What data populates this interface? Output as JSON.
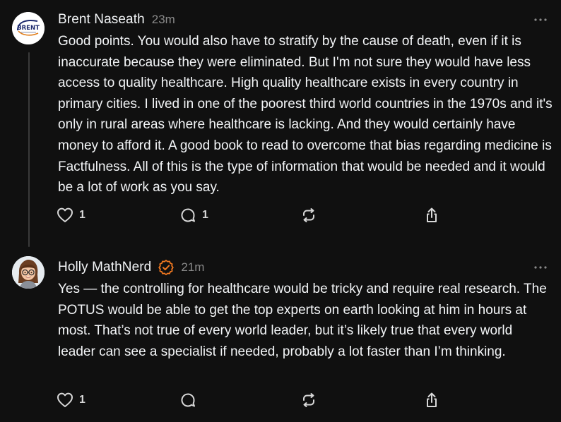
{
  "comments": [
    {
      "author": "Brent Naseath",
      "time": "23m",
      "avatar_logo": "BRENT",
      "verified": false,
      "body": "Good points. You would also have to stratify by the cause of death, even if it is inaccurate because they were eliminated. But I'm not sure they would have less access to quality healthcare. High quality healthcare exists in every country in primary cities. I lived in one of the poorest third world countries in the 1970s and it's only in rural areas where healthcare is lacking. And they would certainly have money to afford it. A good book to read to overcome that bias regarding medicine is Factfulness. All of this is the type of information that would be needed and it would be a lot of work as you say.",
      "likes": "1",
      "replies": "1"
    },
    {
      "author": "Holly MathNerd",
      "time": "21m",
      "verified": true,
      "body": "Yes — the controlling for healthcare would be tricky and require real research. The POTUS would be able to get the top experts on earth looking at him in hours at most. That’s not true of every world leader, but it’s likely true that every world leader can see a specialist if needed, probably a lot faster than I’m thinking.",
      "likes": "1"
    }
  ],
  "colors": {
    "background": "#101010",
    "text": "#f3f5f7",
    "muted": "#8a8a8a",
    "verified_badge": "#f07820",
    "thread_line": "#3a3a3a"
  },
  "icons": {
    "like": "heart-icon",
    "reply": "comment-bubble-icon",
    "repost": "repost-icon",
    "share": "share-icon",
    "more": "more-options-icon",
    "verified": "verified-badge-icon"
  }
}
